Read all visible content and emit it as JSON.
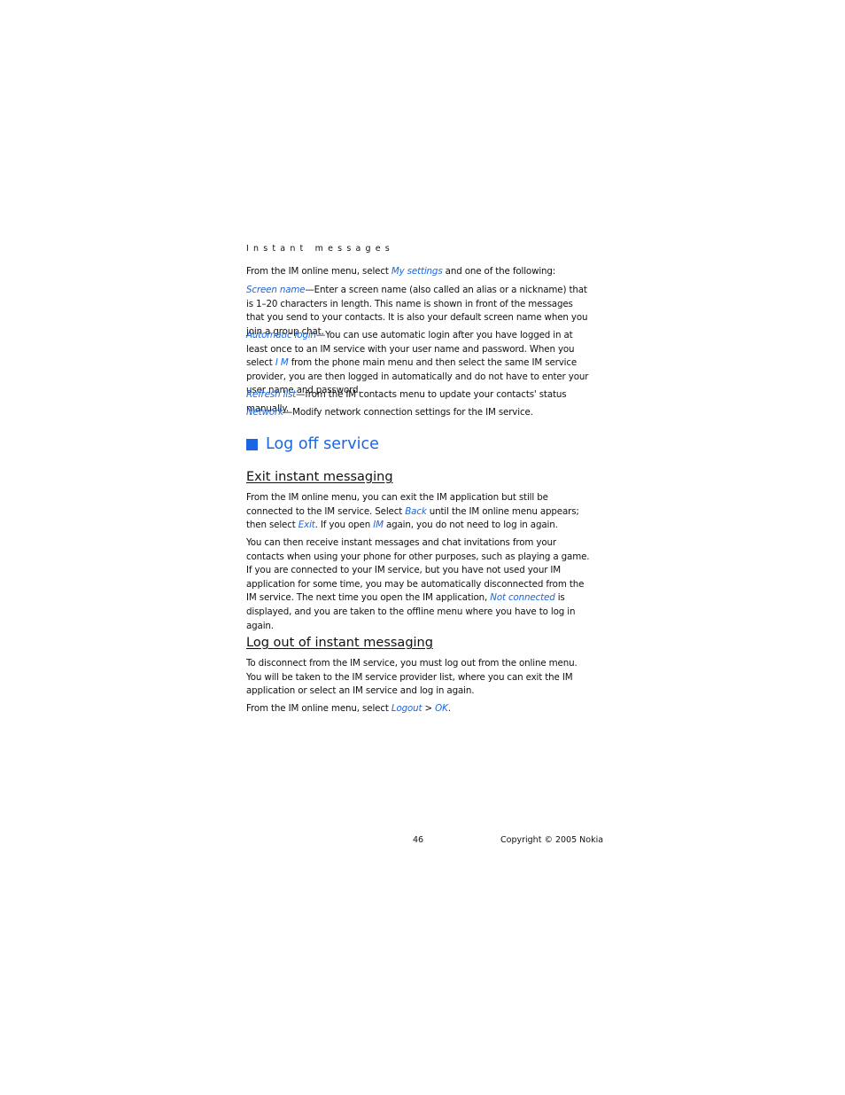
{
  "running_head": "Instant messages",
  "intro": {
    "pre": "From the IM online menu, select ",
    "link": "My settings",
    "post": " and one of the following:"
  },
  "settings": [
    {
      "term": "Screen name",
      "text": "—Enter a screen name (also called an alias or a nickname) that is 1–20 characters in length. This name is shown in front of the messages that you send to your contacts. It is also your default screen name when you join a group chat."
    },
    {
      "term": "Automatic login",
      "text_a": "—You can use automatic login after you have logged in at least once to an IM service with your user name and password. When you select ",
      "link": "I M",
      "text_b": " from the phone main menu and then select the same IM service provider, you are then logged in automatically and do not have to enter your user name and password."
    },
    {
      "term": "Refresh list",
      "text": "—from the IM contacts menu to update your contacts' status manually."
    },
    {
      "term": "Network",
      "text": "—Modify network connection settings for the IM service."
    }
  ],
  "section_title": "Log off service",
  "exit": {
    "heading": "Exit instant messaging",
    "p1": {
      "a": "From the IM online menu, you can exit the IM application but still be connected to the IM service. Select ",
      "link1": "Back",
      "b": " until the IM online menu appears; then select ",
      "link2": "Exit",
      "c": ". If you open ",
      "link3": "IM",
      "d": " again, you do not need to log in again."
    },
    "p2": {
      "a": "You can then receive instant messages and chat invitations from your contacts when using your phone for other purposes, such as playing a game. If you are connected to your IM service, but you have not used your IM application for some time, you may be automatically disconnected from the IM service. The next time you open the IM application, ",
      "link": "Not connected",
      "b": " is displayed, and you are taken to the offline menu where you have to log in again."
    }
  },
  "logout": {
    "heading": "Log out of instant messaging",
    "p1": "To disconnect from the IM service, you must log out from the online menu. You will be taken to the IM service provider list, where you can exit the IM application or select an IM service and log in again.",
    "p2": {
      "pre": "From the IM online menu, select ",
      "link1": "Logout",
      "sep": " > ",
      "link2": "OK",
      "post": "."
    }
  },
  "footer": {
    "page_number": "46",
    "copyright": "Copyright © 2005 Nokia"
  }
}
